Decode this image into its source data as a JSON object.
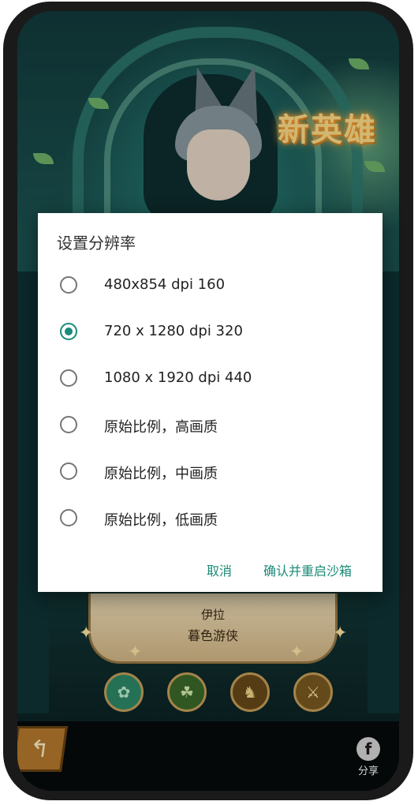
{
  "game": {
    "badge_text": "新英雄",
    "hero_name": "伊拉",
    "hero_title": "暮色游侠",
    "share_label": "分享",
    "share_icon_glyph": "f",
    "back_icon_glyph": "↰",
    "faction_icons": [
      "lightbearer-icon",
      "wilder-icon",
      "graveborn-icon",
      "mauler-icon"
    ]
  },
  "dialog": {
    "title": "设置分辨率",
    "options": [
      {
        "label": "480x854 dpi 160",
        "selected": false
      },
      {
        "label": "720 x 1280 dpi 320",
        "selected": true
      },
      {
        "label": "1080 x 1920 dpi 440",
        "selected": false
      },
      {
        "label": "原始比例，高画质",
        "selected": false
      },
      {
        "label": "原始比例，中画质",
        "selected": false
      },
      {
        "label": "原始比例，低画质",
        "selected": false
      }
    ],
    "cancel_label": "取消",
    "confirm_label": "确认并重启沙箱"
  },
  "colors": {
    "accent": "#1b8a78",
    "radio_off": "#757575",
    "badge": "#ffe08a"
  }
}
